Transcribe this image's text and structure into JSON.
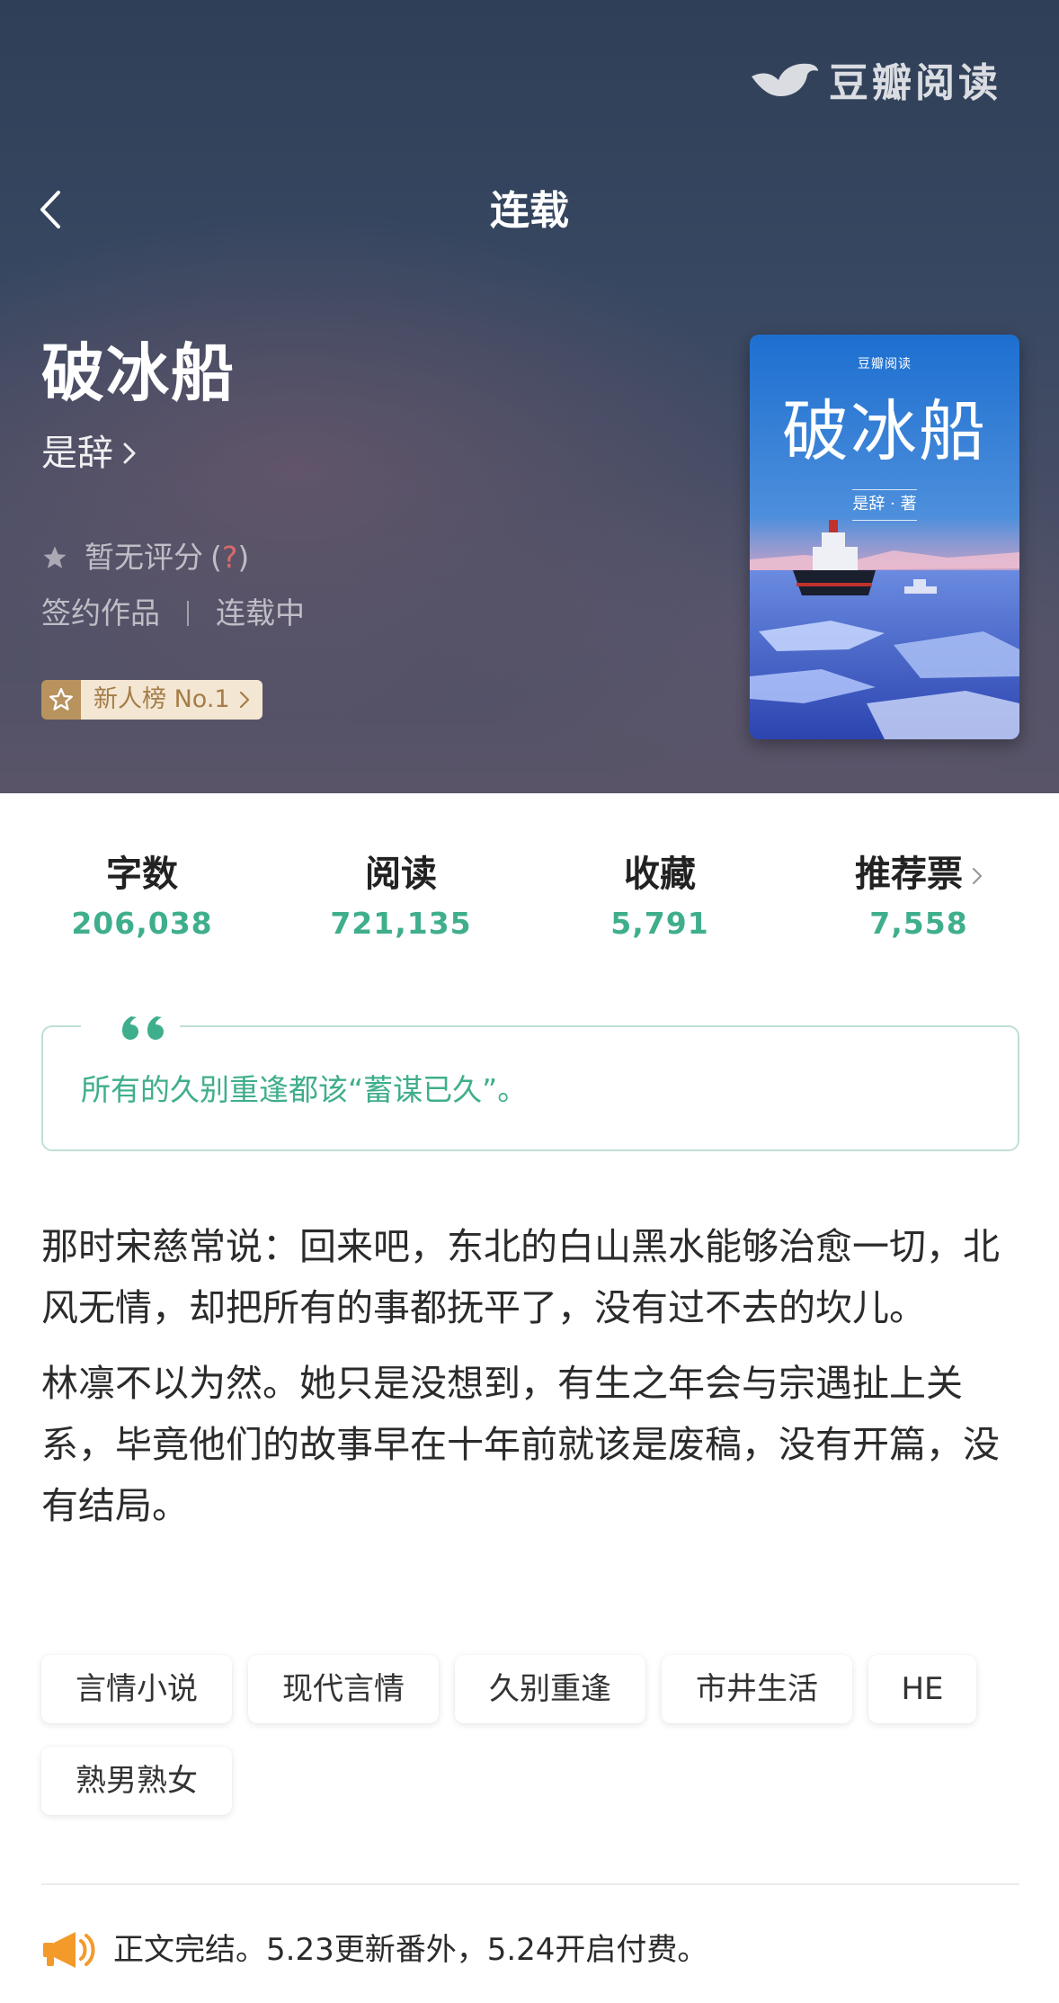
{
  "header": {
    "brand": "豆瓣阅读",
    "nav_title": "连载"
  },
  "book": {
    "title": "破冰船",
    "author": "是辞",
    "rating_text": "暂无评分",
    "rating_help_open": "(",
    "rating_help_q": "?",
    "rating_help_close": ")",
    "sign_status": "签约作品",
    "progress_status": "连载中",
    "rank_badge": "新人榜 No.1"
  },
  "cover": {
    "brand": "豆瓣阅读",
    "title": "破冰船",
    "author_line": "是辞 · 著"
  },
  "stats": [
    {
      "label": "字数",
      "value": "206,038"
    },
    {
      "label": "阅读",
      "value": "721,135"
    },
    {
      "label": "收藏",
      "value": "5,791"
    },
    {
      "label": "推荐票",
      "value": "7,558"
    }
  ],
  "quote": "所有的久别重逢都该“蓄谋已久”。",
  "synopsis": [
    "那时宋慈常说：回来吧，东北的白山黑水能够治愈一切，北风无情，却把所有的事都抚平了，没有过不去的坎儿。",
    "林凛不以为然。她只是没想到，有生之年会与宗遇扯上关系，毕竟他们的故事早在十年前就该是废稿，没有开篇，没有结局。"
  ],
  "tags": [
    "言情小说",
    "现代言情",
    "久别重逢",
    "市井生活",
    "HE",
    "熟男熟女"
  ],
  "notice": "正文完结。5.23更新番外，5.24开启付费。",
  "colors": {
    "accent_green": "#3fae8c",
    "quote_border": "#bfe0d2",
    "badge_gold": "#b8935e",
    "badge_bg": "#f3e6d3",
    "notice_orange": "#f39a2b",
    "help_red": "#d96b6b"
  },
  "icons": {
    "back": "chevron-left-icon",
    "brand": "douban-bird-logo-icon",
    "star": "star-icon",
    "rank": "star-badge-icon",
    "quote": "quote-mark-icon",
    "notice": "megaphone-icon"
  }
}
